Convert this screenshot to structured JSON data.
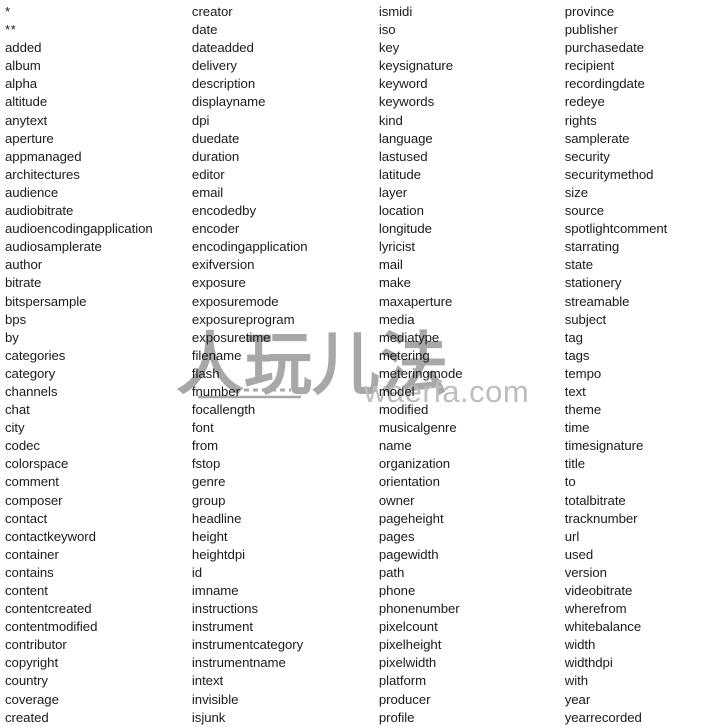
{
  "page": {
    "title": "Spotlight metadata attribute keyword list",
    "background_color": "#ffffff",
    "text_color": "#1b1b1b",
    "column_count": 4
  },
  "watermark": {
    "cjk_text": "人玩儿法",
    "latin_text": "waerfa.com",
    "color": "#a8a8a8"
  },
  "columns": [
    {
      "index": 0,
      "items": [
        "*",
        "**",
        "added",
        "album",
        "alpha",
        "altitude",
        "anytext",
        "aperture",
        "appmanaged",
        "architectures",
        "audience",
        "audiobitrate",
        "audioencodingapplication",
        "audiosamplerate",
        "author",
        "bitrate",
        "bitspersample",
        "bps",
        "by",
        "categories",
        "category",
        "channels",
        "chat",
        "city",
        "codec",
        "colorspace",
        "comment",
        "composer",
        "contact",
        "contactkeyword",
        "container",
        "contains",
        "content",
        "contentcreated",
        "contentmodified",
        "contributor",
        "copyright",
        "country",
        "coverage",
        "created"
      ]
    },
    {
      "index": 1,
      "items": [
        "creator",
        "date",
        "dateadded",
        "delivery",
        "description",
        "displayname",
        "dpi",
        "duedate",
        "duration",
        "editor",
        "email",
        "encodedby",
        "encoder",
        "encodingapplication",
        "exifversion",
        "exposure",
        "exposuremode",
        "exposureprogram",
        "exposuretime",
        "filename",
        "flash",
        "fnumber",
        "focallength",
        "font",
        "from",
        "fstop",
        "genre",
        "group",
        "headline",
        "height",
        "heightdpi",
        "id",
        "imname",
        "instructions",
        "instrument",
        "instrumentcategory",
        "instrumentname",
        "intext",
        "invisible",
        "isjunk"
      ]
    },
    {
      "index": 2,
      "items": [
        "ismidi",
        "iso",
        "key",
        "keysignature",
        "keyword",
        "keywords",
        "kind",
        "language",
        "lastused",
        "latitude",
        "layer",
        "location",
        "longitude",
        "lyricist",
        "mail",
        "make",
        "maxaperture",
        "media",
        "mediatype",
        "metering",
        "meteringmode",
        "model",
        "modified",
        "musicalgenre",
        "name",
        "organization",
        "orientation",
        "owner",
        "pageheight",
        "pages",
        "pagewidth",
        "path",
        "phone",
        "phonenumber",
        "pixelcount",
        "pixelheight",
        "pixelwidth",
        "platform",
        "producer",
        "profile"
      ]
    },
    {
      "index": 3,
      "items": [
        "province",
        "publisher",
        "purchasedate",
        "recipient",
        "recordingdate",
        "redeye",
        "rights",
        "samplerate",
        "security",
        "securitymethod",
        "size",
        "source",
        "spotlightcomment",
        "starrating",
        "state",
        "stationery",
        "streamable",
        "subject",
        "tag",
        "tags",
        "tempo",
        "text",
        "theme",
        "time",
        "timesignature",
        "title",
        "to",
        "totalbitrate",
        "tracknumber",
        "url",
        "used",
        "version",
        "videobitrate",
        "wherefrom",
        "whitebalance",
        "width",
        "widthdpi",
        "with",
        "year",
        "yearrecorded"
      ]
    }
  ]
}
